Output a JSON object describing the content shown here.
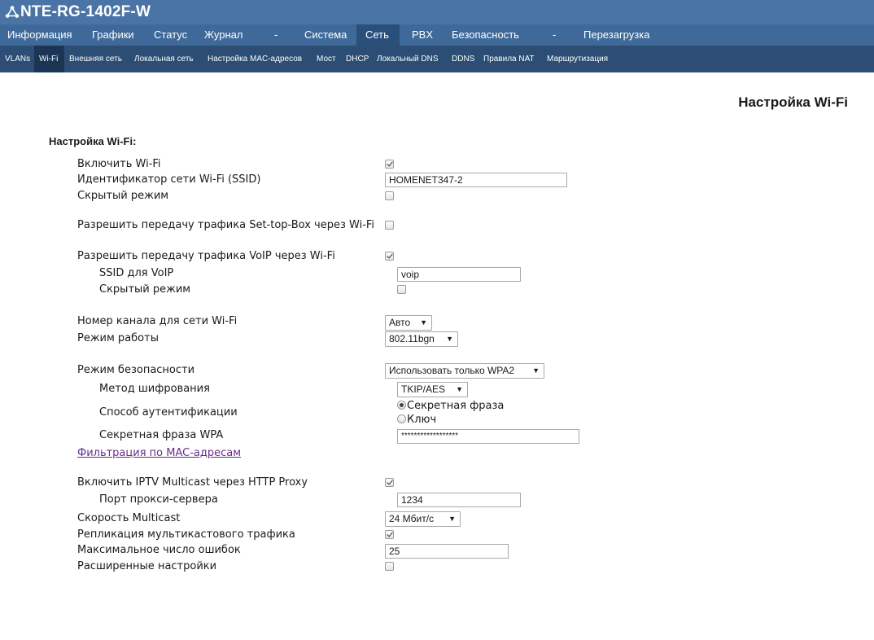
{
  "app": {
    "title": "NTE-RG-1402F-W"
  },
  "menu": [
    {
      "label": "Информация"
    },
    {
      "label": "Графики"
    },
    {
      "label": "Статус"
    },
    {
      "label": "Журнал"
    },
    {
      "label": "-"
    },
    {
      "label": "Система"
    },
    {
      "label": "Сеть",
      "active": true
    },
    {
      "label": "PBX"
    },
    {
      "label": "Безопасность"
    },
    {
      "label": "-"
    },
    {
      "label": "Перезагрузка"
    }
  ],
  "submenu": [
    {
      "label": "VLANs"
    },
    {
      "label": "Wi-Fi",
      "active": true
    },
    {
      "label": "Внешняя сеть"
    },
    {
      "label": "Локальная сеть"
    },
    {
      "label": "Настройка MAC-адресов"
    },
    {
      "label": "Мост"
    },
    {
      "label": "DHCP"
    },
    {
      "label": "Локальный DNS"
    },
    {
      "label": "DDNS"
    },
    {
      "label": "Правила NAT"
    },
    {
      "label": "Маршрутизация"
    }
  ],
  "page_title": "Настройка Wi-Fi",
  "section_title": "Настройка Wi-Fi:",
  "form": {
    "enable_wifi": {
      "label": "Включить Wi-Fi",
      "checked": true
    },
    "ssid": {
      "label": "Идентификатор сети Wi-Fi (SSID)",
      "value": "HOMENET347-2"
    },
    "hidden": {
      "label": "Скрытый режим",
      "checked": false
    },
    "stb": {
      "label": "Разрешить передачу трафика Set-top-Box через Wi-Fi",
      "checked": false
    },
    "voip": {
      "label": "Разрешить передачу трафика VoIP через Wi-Fi",
      "checked": true
    },
    "voip_ssid": {
      "label": "SSID для VoIP",
      "value": "voip"
    },
    "voip_hidden": {
      "label": "Скрытый режим",
      "checked": false
    },
    "channel": {
      "label": "Номер канала для сети Wi-Fi",
      "value": "Авто"
    },
    "mode": {
      "label": "Режим работы",
      "value": "802.11bgn"
    },
    "security": {
      "label": "Режим безопасности",
      "value": "Использовать только WPA2"
    },
    "encryption": {
      "label": "Метод шифрования",
      "value": "TKIP/AES"
    },
    "auth": {
      "label": "Способ аутентификации",
      "option_passphrase": "Секретная фраза",
      "option_key": "Ключ",
      "selected": "passphrase"
    },
    "wpa_phrase": {
      "label": "Секретная фраза WPA",
      "value": "******************"
    },
    "mac_filter_link": "Фильтрация по MAC-адресам",
    "iptv": {
      "label": "Включить IPTV Multicast через HTTP Proxy",
      "checked": true
    },
    "proxy_port": {
      "label": "Порт прокси-сервера",
      "value": "1234"
    },
    "multicast_speed": {
      "label": "Скорость Multicast",
      "value": "24 Мбит/с"
    },
    "replication": {
      "label": "Репликация мультикастового трафика",
      "checked": true
    },
    "max_errors": {
      "label": "Максимальное число ошибок",
      "value": "25"
    },
    "advanced": {
      "label": "Расширенные настройки",
      "checked": false
    }
  }
}
